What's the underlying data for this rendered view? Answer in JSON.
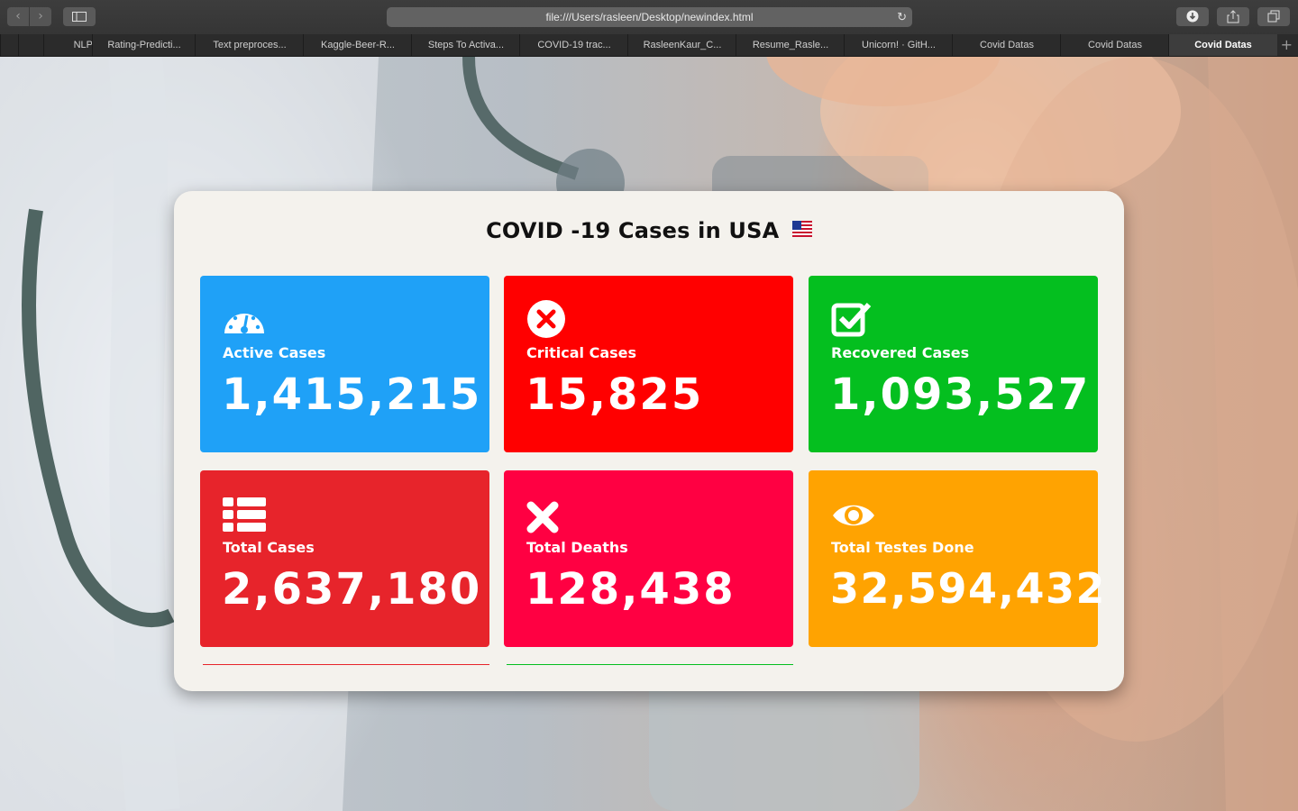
{
  "browser": {
    "url": "file:///Users/rasleen/Desktop/newindex.html",
    "tabs": [
      {
        "label": ""
      },
      {
        "label": ""
      },
      {
        "label": "NLP"
      },
      {
        "label": "Rating-Predicti..."
      },
      {
        "label": "Text preproces..."
      },
      {
        "label": "Kaggle-Beer-R..."
      },
      {
        "label": "Steps To Activa..."
      },
      {
        "label": "COVID-19 trac..."
      },
      {
        "label": "RasleenKaur_C..."
      },
      {
        "label": "Resume_Rasle..."
      },
      {
        "label": "Unicorn! · GitH..."
      },
      {
        "label": "Covid Datas"
      },
      {
        "label": "Covid Datas"
      },
      {
        "label": "Covid Datas"
      }
    ]
  },
  "dashboard": {
    "title": "COVID -19 Cases in USA",
    "tiles": [
      {
        "label": "Active Cases",
        "value": "1,415,215",
        "color": "#1fa1f7",
        "icon": "gauge-icon"
      },
      {
        "label": "Critical Cases",
        "value": "15,825",
        "color": "#ff0000",
        "icon": "x-circle-icon"
      },
      {
        "label": "Recovered Cases",
        "value": "1,093,527",
        "color": "#04bf1f",
        "icon": "check-square-icon"
      },
      {
        "label": "Total Cases",
        "value": "2,637,180",
        "color": "#e7242b",
        "icon": "list-icon"
      },
      {
        "label": "Total Deaths",
        "value": "128,438",
        "color": "#ff0042",
        "icon": "x-icon"
      },
      {
        "label": "Total Testes Done",
        "value": "32,594,432",
        "color": "#ffa301",
        "icon": "eye-icon"
      }
    ]
  }
}
